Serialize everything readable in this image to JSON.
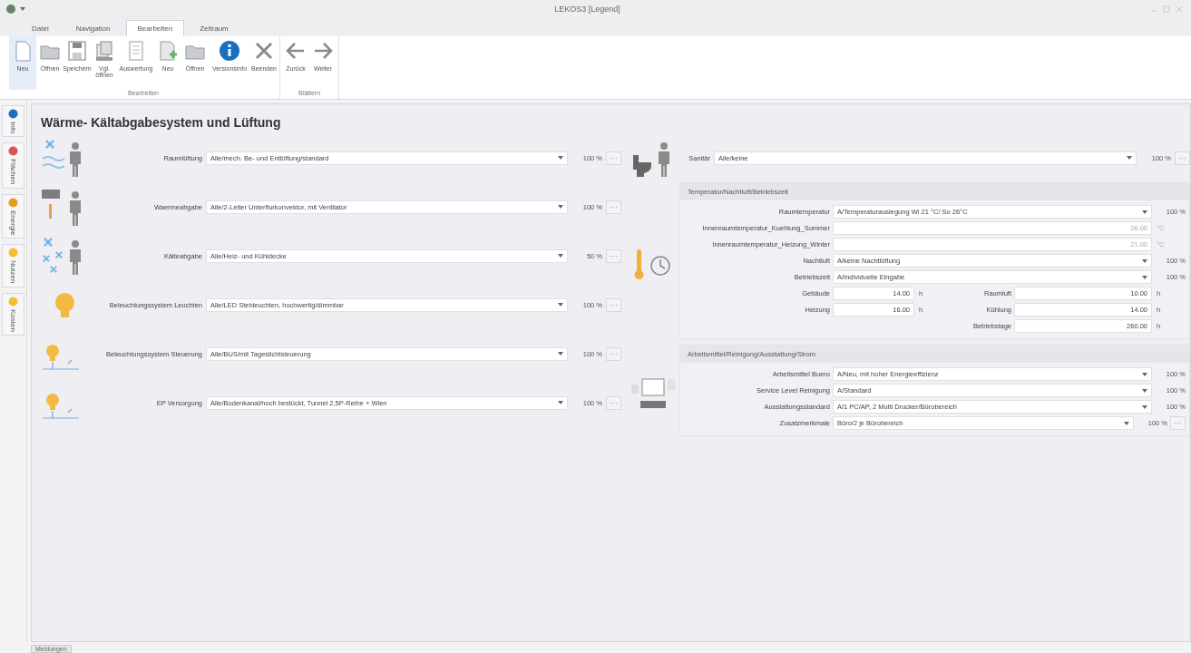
{
  "window": {
    "title": "LEKOS3 [Legend]"
  },
  "ribbon_tabs": [
    {
      "label": "Datei",
      "selected": false
    },
    {
      "label": "Navigation",
      "selected": false
    },
    {
      "label": "Bearbeiten",
      "selected": true
    },
    {
      "label": "Zeitraum",
      "selected": false
    }
  ],
  "ribbon_groups": [
    {
      "label": "Bearbeiten",
      "buttons": [
        {
          "label": "Neu",
          "kind": "new",
          "selected": true
        },
        {
          "label": "Öffnen",
          "kind": "open",
          "selected": false
        },
        {
          "label": "Speichern",
          "kind": "save",
          "selected": false
        },
        {
          "label": "Vgl. öffnen",
          "kind": "compare",
          "selected": false
        },
        {
          "label": "Auswertung",
          "kind": "report",
          "selected": false
        },
        {
          "label": "Neu",
          "kind": "add",
          "selected": false
        },
        {
          "label": "Öffnen",
          "kind": "open",
          "selected": false
        },
        {
          "label": "Versionsinfo",
          "kind": "info",
          "selected": false
        },
        {
          "label": "Beenden",
          "kind": "close",
          "selected": false
        }
      ]
    },
    {
      "label": "Blättern",
      "buttons": [
        {
          "label": "Zurück",
          "kind": "back",
          "selected": false
        },
        {
          "label": "Weiter",
          "kind": "forward",
          "selected": false
        }
      ]
    }
  ],
  "side_tabs": [
    {
      "label": "Info",
      "kind": "info"
    },
    {
      "label": "Flächen",
      "kind": "area"
    },
    {
      "label": "Energie",
      "kind": "energy"
    },
    {
      "label": "Nutzen",
      "kind": "use"
    },
    {
      "label": "Kosten",
      "kind": "cost"
    }
  ],
  "page_title": "Wärme- Kältabgabesystem und Lüftung",
  "left_rows": [
    {
      "kind": "ventilation",
      "label": "Raumlüftung",
      "value": "Alle/mech. Be- und Entlüftung/standard",
      "share": "100 %"
    },
    {
      "kind": "heating",
      "label": "Waermeabgabe",
      "value": "Alle/2-Leiter Unterflurkonvektor, mit Ventilator",
      "share": "100 %"
    },
    {
      "kind": "cooling",
      "label": "Kälteabgabe",
      "value": "Alle/Heiz- und Kühldecke",
      "share": "50 %"
    },
    {
      "kind": "lamp",
      "label": "Beleuchtungssystem Leuchten",
      "value": "Alle/LED Stehleuchten, hochwertig/dimmbar",
      "share": "100 %"
    },
    {
      "kind": "lamp_control",
      "label": "Beleuchtungssystem Steuerung",
      "value": "Alle/BUS/mit Tageslichtsteuerung",
      "share": "100 %"
    },
    {
      "kind": "lamp_control",
      "label": "EP Versorgung",
      "value": "Alle/Bodenkanal/hoch bestückt, Tunnel 2,5P-Reihe + Wien",
      "share": "100 %"
    }
  ],
  "sanitary": {
    "label": "Sanitär",
    "value": "Alle/keine",
    "share": "100 %"
  },
  "groups": [
    {
      "kind": "temperature",
      "title": "Temperatur/Nachtluft/Betriebszeit",
      "rows": [
        {
          "kind": "select",
          "label": "Raumtemperatur",
          "value": "A/Temperaturauslegung Wi 21 °C/ So 26°C",
          "share": "100 %",
          "has_button": false
        },
        {
          "kind": "number",
          "label": "Innenraumtemperatur_Kuehlung_Sommer",
          "value": "26.00",
          "unit": "°C",
          "disabled": true
        },
        {
          "kind": "number",
          "label": "Innenraumtemperatur_Heizung_Winter",
          "value": "21.00",
          "unit": "°C",
          "disabled": true
        },
        {
          "kind": "select",
          "label": "Nachtluft",
          "value": "A/keine Nachtlüftung",
          "share": "100 %",
          "has_button": false
        },
        {
          "kind": "select",
          "label": "Betriebszeit",
          "value": "A/Individuelle Eingabe",
          "share": "100 %",
          "has_button": false
        }
      ],
      "grid": [
        {
          "label": "Gebäude",
          "value": "14.00",
          "unit": "h"
        },
        {
          "label": "Raumluft",
          "value": "10.00",
          "unit": "h"
        },
        {
          "label": "Heizung",
          "value": "16.00",
          "unit": "h"
        },
        {
          "label": "Kühlung",
          "value": "14.00",
          "unit": "h"
        },
        {
          "label": "Betriebstage",
          "value": "260.00",
          "unit": "h"
        }
      ]
    },
    {
      "kind": "equipment",
      "title": "Arbeitsmittel/Reinigung/Ausstattung/Strom",
      "rows": [
        {
          "kind": "select",
          "label": "Arbeitsmittel Buero",
          "value": "A/Neu, mit hoher Energieeffizienz",
          "share": "100 %",
          "has_button": false
        },
        {
          "kind": "select",
          "label": "Service Level Reinigung",
          "value": "A/Standard",
          "share": "100 %",
          "has_button": false
        },
        {
          "kind": "select",
          "label": "Ausstattungsstandard",
          "value": "A/1 PC/AP, 2 Multi Drucker/Bürobereich",
          "share": "100 %",
          "has_button": false
        },
        {
          "kind": "select",
          "label": "Zusatzmerkmale",
          "value": "Büro/2 je Bürobereich",
          "share": "100 %",
          "has_button": true
        }
      ]
    }
  ],
  "status_tab": {
    "label": "Meldungen"
  }
}
